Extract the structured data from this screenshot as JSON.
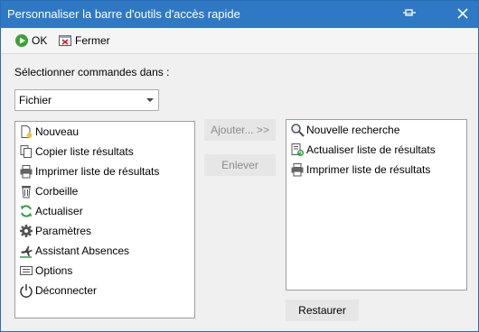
{
  "window": {
    "title": "Personnaliser la barre d'outils d'accès rapide",
    "pin_icon": "pin-icon",
    "close_icon": "close-icon"
  },
  "toolbar": {
    "ok_label": "OK",
    "close_label": "Fermer"
  },
  "commands": {
    "label": "Sélectionner commandes dans :",
    "selected": "Fichier"
  },
  "available_items": [
    {
      "label": "Nouveau",
      "icon": "new-document-icon"
    },
    {
      "label": "Copier liste résultats",
      "icon": "copy-icon"
    },
    {
      "label": "Imprimer liste de résultats",
      "icon": "printer-icon"
    },
    {
      "label": "Corbeille",
      "icon": "trash-icon"
    },
    {
      "label": "Actualiser",
      "icon": "refresh-icon"
    },
    {
      "label": "Paramètres",
      "icon": "gear-icon"
    },
    {
      "label": "Assistant Absences",
      "icon": "airplane-icon"
    },
    {
      "label": "Options",
      "icon": "options-icon"
    },
    {
      "label": "Déconnecter",
      "icon": "power-icon"
    }
  ],
  "quick_access_items": [
    {
      "label": "Nouvelle recherche",
      "icon": "magnifier-icon"
    },
    {
      "label": "Actualiser liste de résultats",
      "icon": "refresh-list-icon"
    },
    {
      "label": "Imprimer liste de résultats",
      "icon": "printer-icon"
    }
  ],
  "buttons": {
    "add": "Ajouter... >>",
    "remove": "Enlever",
    "restore": "Restaurer"
  },
  "colors": {
    "titlebar": "#2f79c4",
    "ok_green": "#3aa335",
    "close_red": "#d32f2f"
  }
}
